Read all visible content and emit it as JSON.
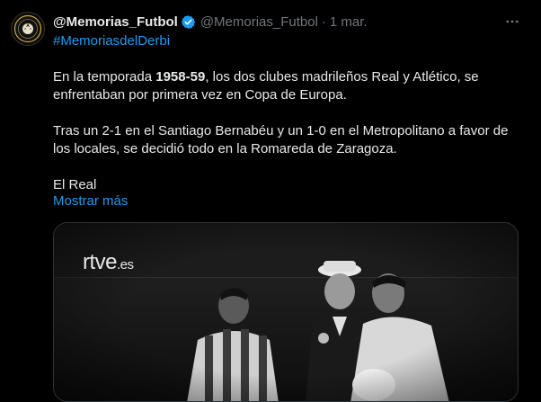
{
  "author": {
    "name": "@Memorias_Futbol",
    "handle": "@Memorias_Futbol",
    "separator": "·",
    "date": "1 mar.",
    "avatar_text": "MEMORIAS FUTBOL"
  },
  "hashtag": "#MemoriasdelDerbi",
  "text": {
    "p1_a": "En la temporada ",
    "p1_bold": "1958-59",
    "p1_b": ", los dos clubes madrileños Real y Atlético, se enfrentaban por primera vez en Copa de Europa.",
    "p2": "Tras un 2-1 en el Santiago Bernabéu y un 1-0 en el Metropolitano a favor de los locales, se decidió todo en la Romareda de Zaragoza.",
    "p3": "El Real"
  },
  "show_more": "Mostrar más",
  "media": {
    "watermark_main": "rtve",
    "watermark_suffix": ".es"
  },
  "colors": {
    "accent": "#1d9bf0",
    "muted": "#71767b",
    "background": "#000000",
    "text": "#e7e9ea"
  },
  "icons": [
    "verified-badge-icon",
    "more-options-icon"
  ]
}
